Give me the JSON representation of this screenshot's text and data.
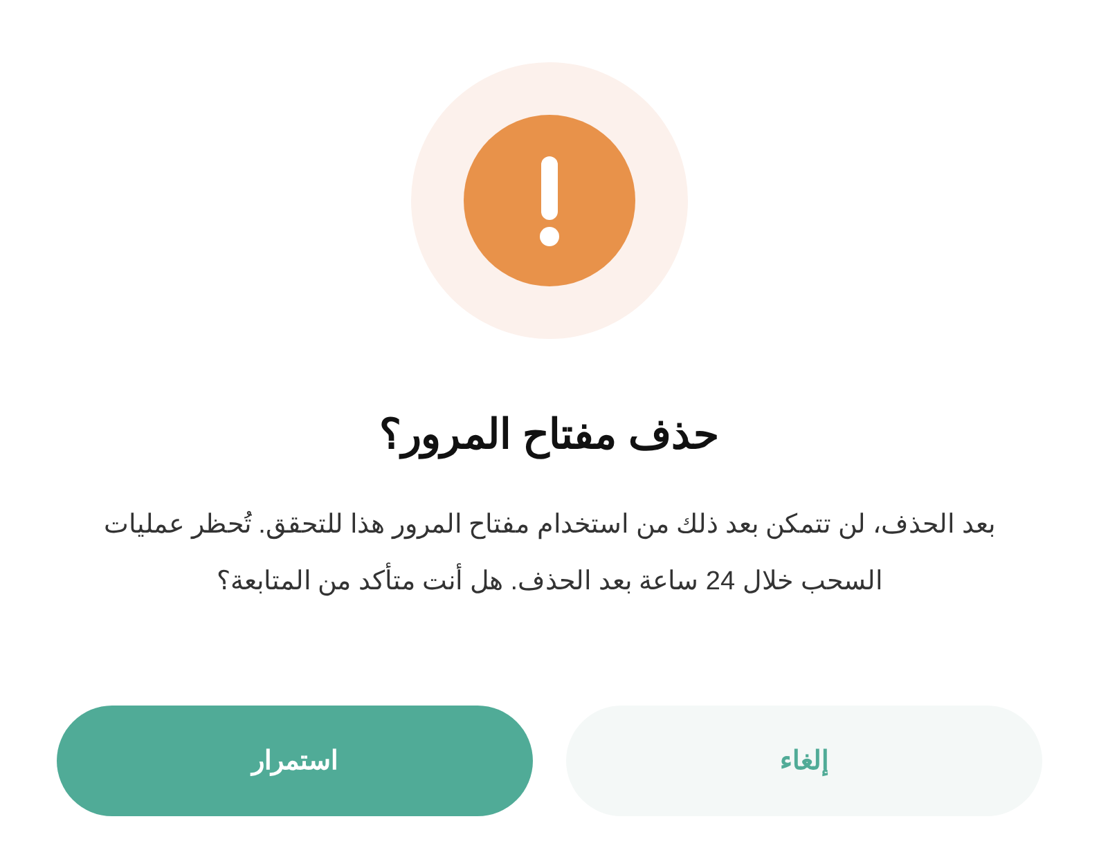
{
  "dialog": {
    "title": "حذف مفتاح المرور؟",
    "message": "بعد الحذف، لن تتمكن بعد ذلك من استخدام مفتاح المرور هذا للتحقق. تُحظر عمليات السحب خلال 24 ساعة بعد الحذف. هل أنت متأكد من المتابعة؟",
    "buttons": [
      {
        "label": "إلغاء",
        "kind": "secondary"
      },
      {
        "label": "استمرار",
        "kind": "primary"
      }
    ]
  }
}
